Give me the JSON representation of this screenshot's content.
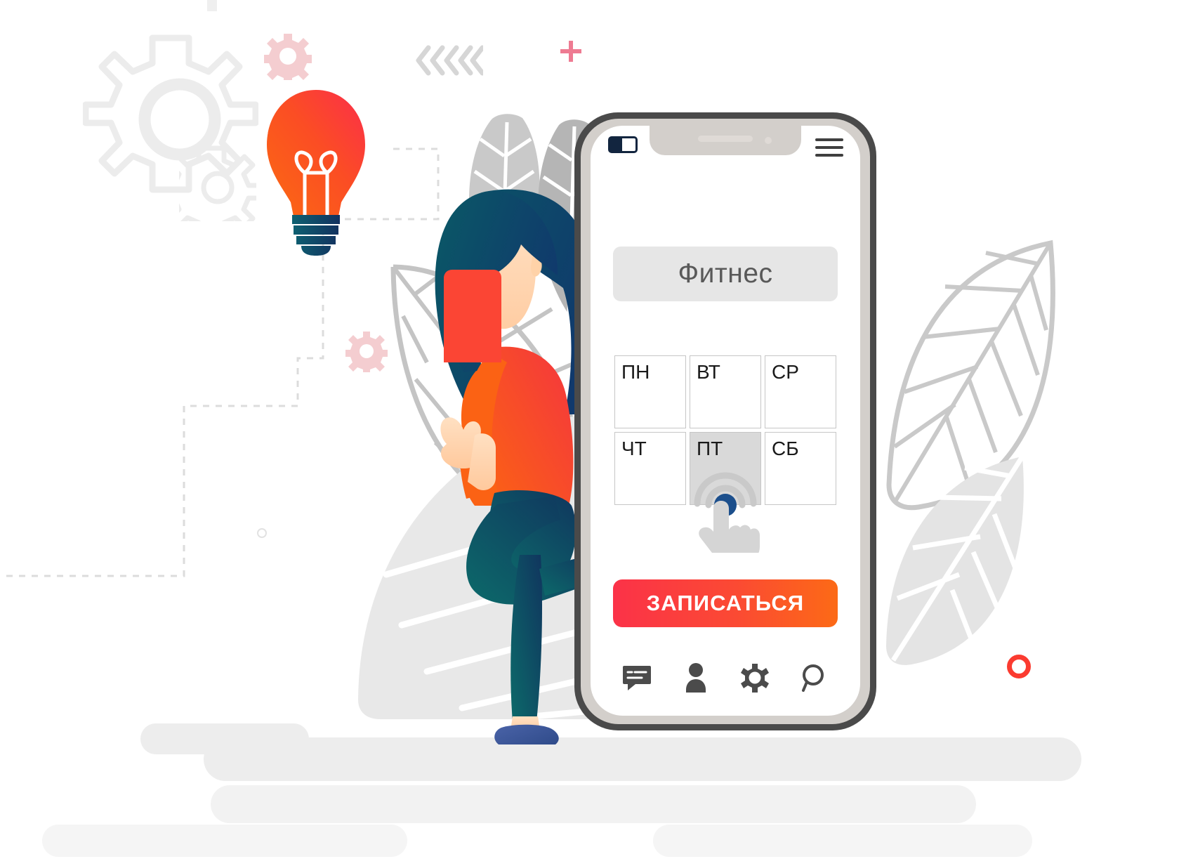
{
  "illustration": {
    "title": "Fitness booking mobile app illustration",
    "theme_colors": {
      "accent_red": "#fb3248",
      "accent_orange": "#fc6a16",
      "hair_teal": "#0b5562",
      "hair_navy": "#123a6b",
      "skin": "#ffd2a8",
      "pants_teal": "#0d6068",
      "shoe_blue": "#3b5ba5",
      "leaf_gray": "#c9c9c9",
      "bg_gray": "#ededed",
      "pink": "#f0b8c0",
      "phone_frame": "#4a4a4a",
      "phone_bezel": "#d3cfcb"
    }
  },
  "phone": {
    "statusbar": {
      "battery_label": "battery-low",
      "menu_label": "menu"
    },
    "title_field": {
      "value": "Фитнес",
      "placeholder": "Фитнес"
    },
    "day_grid": {
      "selected_index": 4,
      "days": [
        {
          "label": "ПН",
          "selected": false
        },
        {
          "label": "ВТ",
          "selected": false
        },
        {
          "label": "СР",
          "selected": false
        },
        {
          "label": "ЧТ",
          "selected": false
        },
        {
          "label": "ПТ",
          "selected": true
        },
        {
          "label": "СБ",
          "selected": false
        }
      ]
    },
    "cta": {
      "label": "ЗАПИСАТЬСЯ"
    },
    "bottom_nav": [
      {
        "icon": "chat-icon",
        "label": "Чат"
      },
      {
        "icon": "person-icon",
        "label": "Профиль"
      },
      {
        "icon": "gear-icon",
        "label": "Настройки"
      },
      {
        "icon": "search-icon",
        "label": "Поиск"
      }
    ]
  },
  "decor": {
    "gear_large": "gear-outline-icon",
    "gear_small": "gear-outline-icon",
    "gear_pink_top": "gear-pink-icon",
    "gear_pink_mid": "gear-pink-icon",
    "chevrons": "chevrons-left-icon",
    "plus": "plus-icon",
    "ring": "circle-outline-icon",
    "lightbulb": "lightbulb-icon",
    "leaves": "leaf-icon",
    "dashed_path": "dashed-connector"
  }
}
